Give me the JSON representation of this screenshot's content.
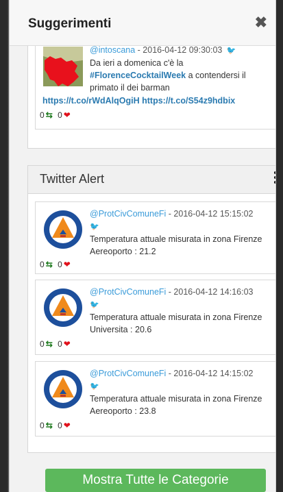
{
  "modal": {
    "title": "Suggerimenti",
    "close_glyph": "✖"
  },
  "top_tweet": {
    "user": "@intoscana",
    "date": " - 2016-04-12 09:30:03 ",
    "text_before": "Da ieri a domenica c'è la ",
    "hashtag": "#FlorenceCocktailWeek",
    "text_after": " a contendersi il primato il dei barman",
    "links": "https://t.co/rWdAlqOgiH https://t.co/S54z9hdbix",
    "retweets": "0",
    "likes": "0",
    "avatar_icon": "tuscany-map-icon"
  },
  "twitter_alert": {
    "title": "Twitter Alert",
    "tweets": [
      {
        "user": "@ProtCivComuneFi",
        "date": " - 2016-04-12 15:15:02",
        "text": "Temperatura attuale misurata in zona Firenze Aereoporto : 21.2",
        "retweets": "0",
        "likes": "0"
      },
      {
        "user": "@ProtCivComuneFi",
        "date": " - 2016-04-12 14:16:03",
        "text": "Temperatura attuale misurata in zona Firenze Universita : 20.6",
        "retweets": "0",
        "likes": "0"
      },
      {
        "user": "@ProtCivComuneFi",
        "date": " - 2016-04-12 14:15:02",
        "text": "Temperatura attuale misurata in zona Firenze Aereoporto : 23.8",
        "retweets": "0",
        "likes": "0"
      }
    ]
  },
  "footer": {
    "show_all_label": "Mostra Tutte le Categorie"
  },
  "colors": {
    "accent_green": "#5cb85c",
    "link_blue": "#3a9bd9",
    "heart_red": "#e0111c",
    "retweet_green": "#1f7a1f"
  }
}
